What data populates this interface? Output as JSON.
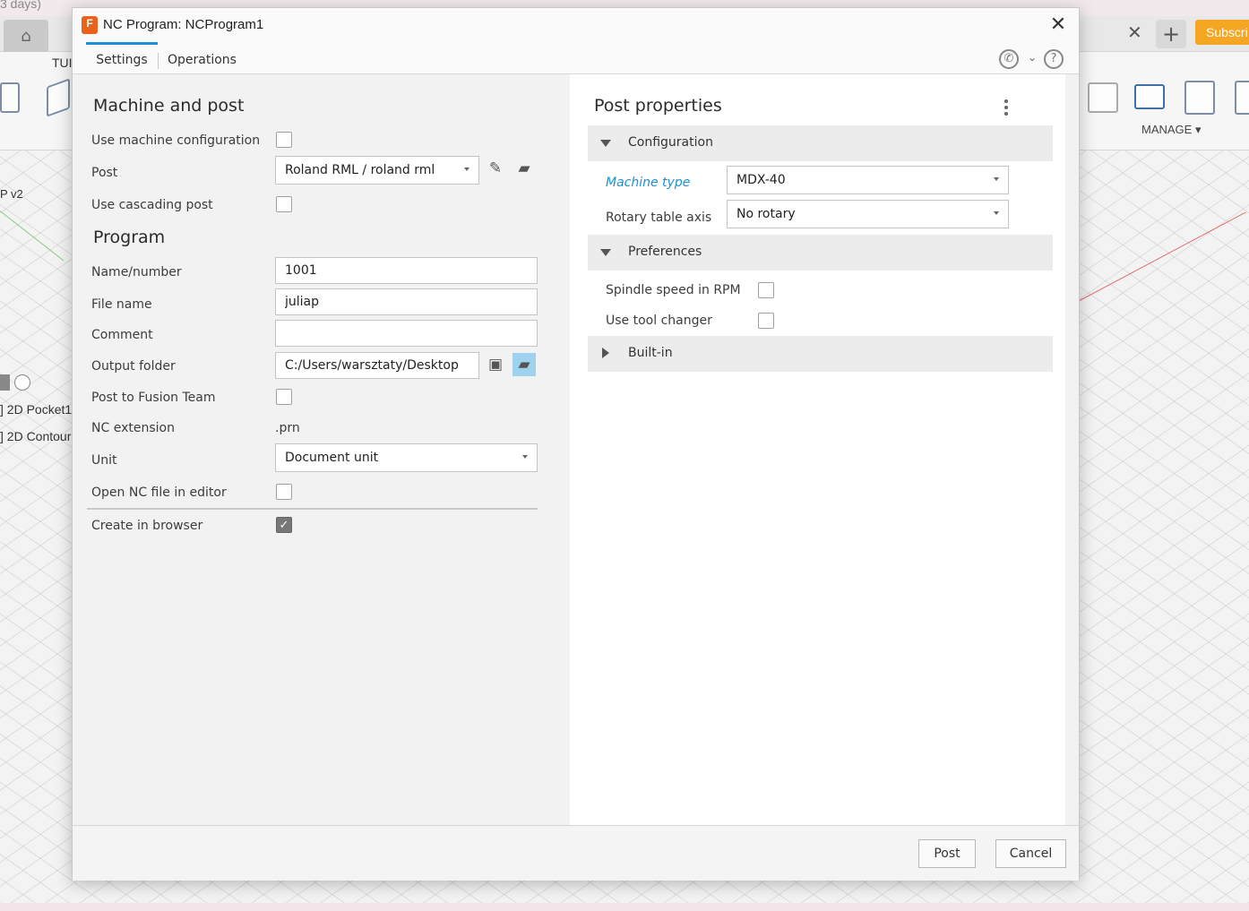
{
  "background": {
    "top_hint": "3 days)",
    "tab_partial": "TUI",
    "subscribe": "Subscri",
    "manage": "MANAGE ▾",
    "browser_v2": "P v2",
    "browser_items": [
      "] 2D Pocket1",
      "] 2D Contour"
    ]
  },
  "dialog": {
    "title": "NC Program: NCProgram1",
    "tabs": [
      "Settings",
      "Operations"
    ],
    "active_tab": "Settings"
  },
  "left": {
    "machine_title": "Machine and post",
    "use_machine_config": "Use machine configuration",
    "post_label": "Post",
    "post_value": "Roland RML / roland rml",
    "use_cascading": "Use cascading post",
    "program_title": "Program",
    "name_label": "Name/number",
    "name_value": "1001",
    "filename_label": "File name",
    "filename_value": "juliap",
    "comment_label": "Comment",
    "comment_value": "",
    "output_label": "Output folder",
    "output_value": "C:/Users/warsztaty/Desktop",
    "post_fusion_label": "Post to Fusion Team",
    "nc_ext_label": "NC extension",
    "nc_ext_value": ".prn",
    "unit_label": "Unit",
    "unit_value": "Document unit",
    "open_nc_label": "Open NC file in editor",
    "create_browser_label": "Create in browser"
  },
  "right": {
    "title": "Post properties",
    "configuration": "Configuration",
    "machine_type_label": "Machine type",
    "machine_type_value": "MDX-40",
    "rotary_label": "Rotary table axis",
    "rotary_value": "No rotary",
    "preferences": "Preferences",
    "spindle_label": "Spindle speed in RPM",
    "tool_changer_label": "Use tool changer",
    "builtin": "Built-in"
  },
  "footer": {
    "post": "Post",
    "cancel": "Cancel"
  }
}
